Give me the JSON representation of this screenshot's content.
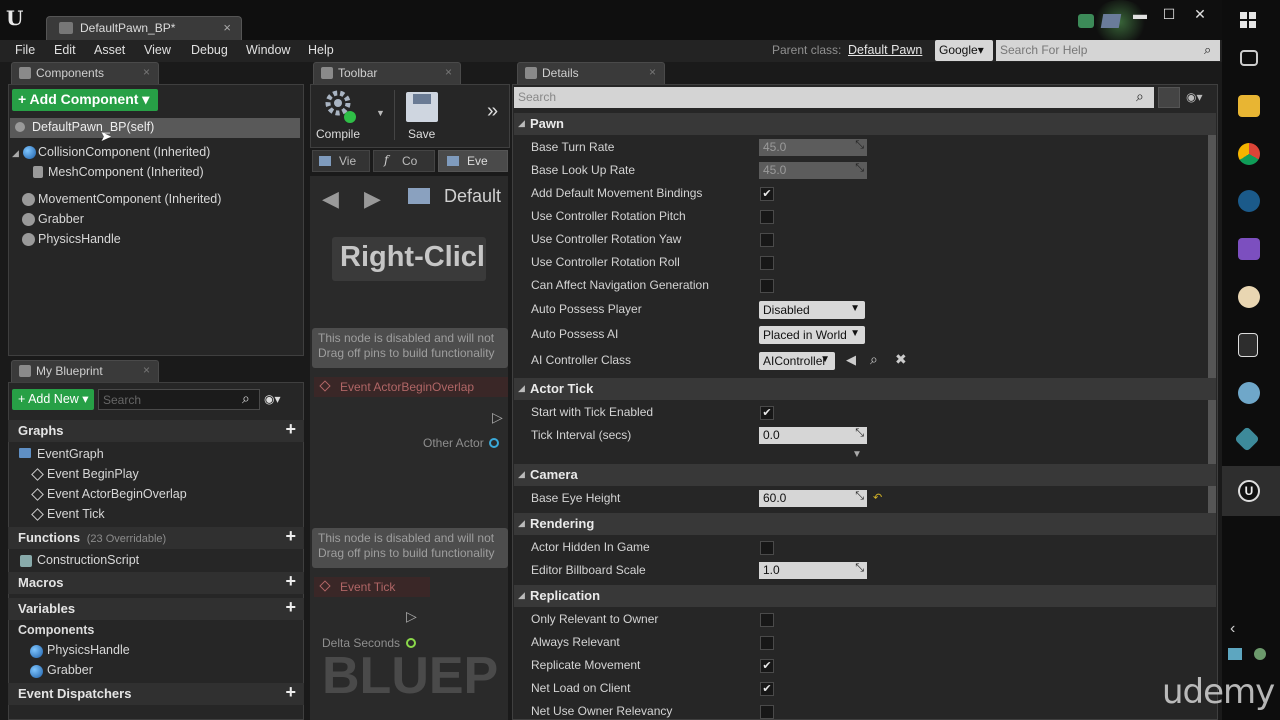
{
  "window": {
    "tab_title": "DefaultPawn_BP*",
    "tab_close": "×",
    "minimize": "▬",
    "maximize": "☐",
    "close": "✕",
    "logo": "U"
  },
  "menu": {
    "items": [
      "File",
      "Edit",
      "Asset",
      "View",
      "Debug",
      "Window",
      "Help"
    ],
    "parent_class_label": "Parent class:",
    "parent_class_value": "Default Pawn",
    "search_provider": "Google▾",
    "help_search_placeholder": "Search For Help"
  },
  "components_panel": {
    "tab_label": "Components",
    "add_button": "+ Add Component ▾",
    "self_item": "DefaultPawn_BP(self)",
    "items": [
      "CollisionComponent (Inherited)",
      "MeshComponent (Inherited)",
      "MovementComponent (Inherited)",
      "Grabber",
      "PhysicsHandle"
    ]
  },
  "my_blueprint": {
    "tab_label": "My Blueprint",
    "add_new": "+ Add New ▾",
    "search_placeholder": "Search",
    "graphs_label": "Graphs",
    "event_graph": "EventGraph",
    "events": [
      "Event BeginPlay",
      "Event ActorBeginOverlap",
      "Event Tick"
    ],
    "functions_label": "Functions",
    "functions_count": "(23 Overridable)",
    "construction_script": "ConstructionScript",
    "macros_label": "Macros",
    "variables_label": "Variables",
    "components_label": "Components",
    "component_vars": [
      "PhysicsHandle",
      "Grabber"
    ],
    "event_dispatchers_label": "Event Dispatchers",
    "plus": "+"
  },
  "toolbar": {
    "tab_label": "Toolbar",
    "compile": "Compile",
    "save": "Save",
    "more": "»"
  },
  "graph": {
    "tabs": [
      "Vie",
      "Co",
      "Eve"
    ],
    "breadcrumb": "Default",
    "hint": "Right-Clicl",
    "disabled_line1": "This node is disabled and will not",
    "disabled_line2": "Drag off pins to build functionality",
    "event_overlap": "Event ActorBeginOverlap",
    "other_actor": "Other Actor",
    "event_tick": "Event Tick",
    "delta_seconds": "Delta Seconds",
    "watermark": "BLUEP"
  },
  "details": {
    "tab_label": "Details",
    "search_placeholder": "Search",
    "pawn": {
      "header": "Pawn",
      "base_turn_rate_label": "Base Turn Rate",
      "base_turn_rate": "45.0",
      "base_look_up_rate_label": "Base Look Up Rate",
      "base_look_up_rate": "45.0",
      "add_default_movement_label": "Add Default Movement Bindings",
      "use_pitch_label": "Use Controller Rotation Pitch",
      "use_yaw_label": "Use Controller Rotation Yaw",
      "use_roll_label": "Use Controller Rotation Roll",
      "can_affect_nav_label": "Can Affect Navigation Generation",
      "auto_possess_player_label": "Auto Possess Player",
      "auto_possess_player": "Disabled",
      "auto_possess_ai_label": "Auto Possess AI",
      "auto_possess_ai": "Placed in World",
      "ai_controller_label": "AI Controller Class",
      "ai_controller": "AIController"
    },
    "actor_tick": {
      "header": "Actor Tick",
      "start_tick_label": "Start with Tick Enabled",
      "tick_interval_label": "Tick Interval (secs)",
      "tick_interval": "0.0"
    },
    "camera": {
      "header": "Camera",
      "base_eye_height_label": "Base Eye Height",
      "base_eye_height": "60.0"
    },
    "rendering": {
      "header": "Rendering",
      "actor_hidden_label": "Actor Hidden In Game",
      "billboard_scale_label": "Editor Billboard Scale",
      "billboard_scale": "1.0"
    },
    "replication": {
      "header": "Replication",
      "only_relevant_owner_label": "Only Relevant to Owner",
      "always_relevant_label": "Always Relevant",
      "replicate_movement_label": "Replicate Movement",
      "net_load_client_label": "Net Load on Client",
      "net_use_owner_label": "Net Use Owner Relevancy"
    },
    "check": "✔"
  },
  "watermark": "udemy",
  "colors": {
    "add_button": "#27a046",
    "editor_bg": "#262626"
  }
}
